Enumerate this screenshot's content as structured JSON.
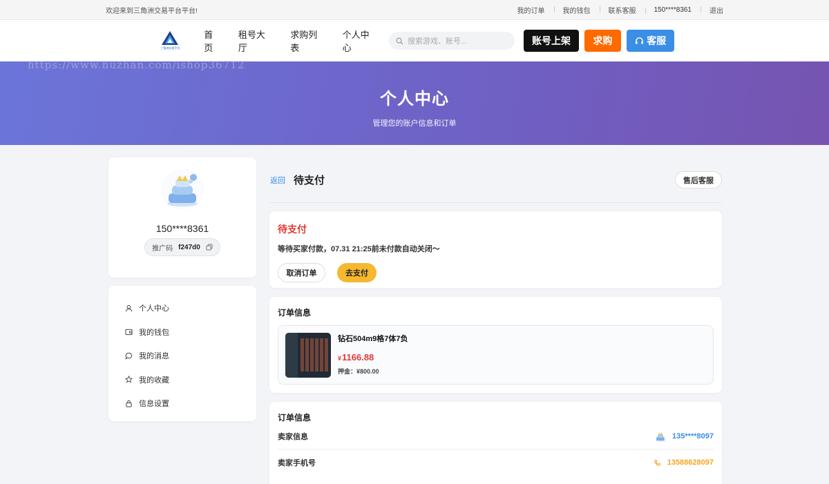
{
  "topbar": {
    "welcome": "欢迎来到三角洲交易平台平台!",
    "links": [
      "我的订单",
      "我的钱包",
      "联系客服"
    ],
    "phone": "150****8361",
    "logout": "退出"
  },
  "nav": {
    "logo_text": "三角洲交易平台",
    "menu": [
      "首页",
      "租号大厅",
      "求购列表",
      "个人中心"
    ],
    "search_placeholder": "搜索游戏、账号...",
    "btn_list": "账号上架",
    "btn_buy": "求购",
    "btn_cs": "客服"
  },
  "banner": {
    "title": "个人中心",
    "subtitle": "管理您的账户信息和订单",
    "watermark": "https://www.huzhan.com/ishop36712"
  },
  "profile": {
    "username": "150****8361",
    "promo_label": "推广码",
    "promo_code": "f247d0"
  },
  "side_menu": [
    "个人中心",
    "我的钱包",
    "我的消息",
    "我的收藏",
    "信息设置"
  ],
  "order": {
    "back": "返回",
    "title": "待支付",
    "after_sales": "售后客服",
    "status": "待支付",
    "desc": "等待买家付款，07.31 21:25前未付款自动关闭～",
    "cancel": "取消订单",
    "pay": "去支付",
    "section1_title": "订单信息",
    "goods_name": "钻石504m9格7体7负",
    "currency": "¥",
    "price": "1166.88",
    "deposit": "押金：¥800.00",
    "section2_title": "订单信息",
    "rows": [
      {
        "label": "卖家信息",
        "value": "135****8097"
      },
      {
        "label": "卖家手机号",
        "value": "13588628097"
      }
    ]
  },
  "colors": {
    "accent_blue": "#3a8ee6",
    "accent_orange": "#ff6a00",
    "pay_yellow": "#f5b82e",
    "status_red": "#e53935"
  }
}
